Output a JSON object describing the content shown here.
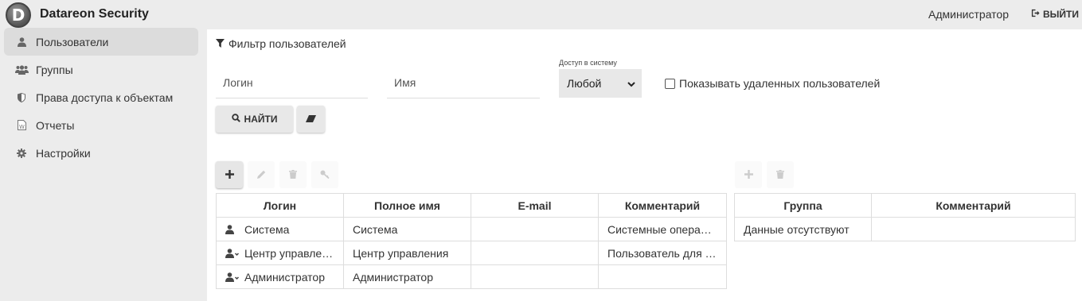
{
  "app": {
    "title": "Datareon Security",
    "logo_letter": "D"
  },
  "header": {
    "user": "Администратор",
    "logout_label": "ВЫЙТИ"
  },
  "sidebar": {
    "items": [
      {
        "label": "Пользователи",
        "icon": "user-icon",
        "active": true
      },
      {
        "label": "Группы",
        "icon": "users-icon",
        "active": false
      },
      {
        "label": "Права доступа к объектам",
        "icon": "shield-icon",
        "active": false
      },
      {
        "label": "Отчеты",
        "icon": "document-icon",
        "active": false
      },
      {
        "label": "Настройки",
        "icon": "gear-icon",
        "active": false
      }
    ]
  },
  "filter": {
    "title": "Фильтр пользователей",
    "login_placeholder": "Логин",
    "name_placeholder": "Имя",
    "access_label": "Доступ в систему",
    "access_value": "Любой",
    "show_deleted_label": "Показывать удаленных пользователей",
    "show_deleted_checked": false,
    "find_label": "НАЙТИ"
  },
  "users_table": {
    "columns": [
      "Логин",
      "Полное имя",
      "E-mail",
      "Комментарий"
    ],
    "rows": [
      {
        "login": "Система",
        "full_name": "Система",
        "email": "",
        "comment": "Системные операц…",
        "expandable": false
      },
      {
        "login": "Центр управле…",
        "full_name": "Центр управления",
        "email": "",
        "comment": "Пользователь для …",
        "expandable": true
      },
      {
        "login": "Администратор",
        "full_name": "Администратор",
        "email": "",
        "comment": "",
        "expandable": true
      }
    ]
  },
  "groups_table": {
    "columns": [
      "Группа",
      "Комментарий"
    ],
    "empty_text": "Данные отсутствуют"
  }
}
